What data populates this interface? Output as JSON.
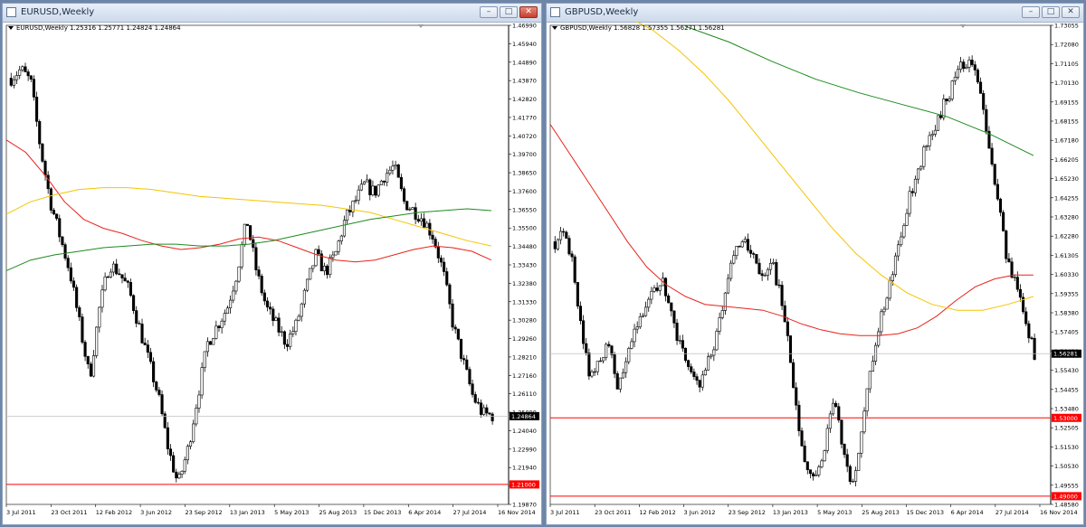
{
  "windows": [
    {
      "id": "eurusd",
      "title": "EURUSD,Weekly",
      "info_symbol": "EURUSD,Weekly",
      "info_ohlc": "1.25316 1.25771 1.24824 1.24864",
      "y_ticks": [
        "1.46990",
        "1.45940",
        "1.44890",
        "1.43870",
        "1.42820",
        "1.41770",
        "1.40720",
        "1.39700",
        "1.38650",
        "1.37600",
        "1.36550",
        "1.35500",
        "1.34480",
        "1.33430",
        "1.32380",
        "1.31330",
        "1.30280",
        "1.29260",
        "1.28210",
        "1.27160",
        "1.26110",
        "1.25090",
        "1.24040",
        "1.22990",
        "1.21940",
        "1.20890",
        "1.19870"
      ],
      "x_ticks": [
        "3 Jul 2011",
        "23 Oct 2011",
        "12 Feb 2012",
        "3 Jun 2012",
        "23 Sep 2012",
        "13 Jan 2013",
        "5 May 2013",
        "25 Aug 2013",
        "15 Dec 2013",
        "6 Apr 2014",
        "27 Jul 2014",
        "16 Nov 2014"
      ],
      "price_label": "1.24864",
      "level_label": "1.21000",
      "colors": {
        "price_label_bg": "#000000",
        "level_label_bg": "#ff0000",
        "level_line": "#ff0000",
        "ma_red": "#e8221b",
        "ma_yellow": "#f5c400",
        "ma_green": "#1d8a1d",
        "candle": "#000000"
      }
    },
    {
      "id": "gbpusd",
      "title": "GBPUSD,Weekly",
      "info_symbol": "GBPUSD,Weekly",
      "info_ohlc": "1.56828 1.57355 1.56271 1.56281",
      "y_ticks": [
        "1.73055",
        "1.72080",
        "1.71105",
        "1.70130",
        "1.69155",
        "1.68155",
        "1.67180",
        "1.66205",
        "1.65230",
        "1.64255",
        "1.63280",
        "1.62280",
        "1.61305",
        "1.60330",
        "1.59355",
        "1.58380",
        "1.57405",
        "1.56430",
        "1.55430",
        "1.54455",
        "1.53480",
        "1.52505",
        "1.51530",
        "1.50530",
        "1.49555",
        "1.48580"
      ],
      "x_ticks": [
        "3 Jul 2011",
        "23 Oct 2011",
        "12 Feb 2012",
        "3 Jun 2012",
        "23 Sep 2012",
        "13 Jan 2013",
        "5 May 2013",
        "25 Aug 2013",
        "15 Dec 2013",
        "6 Apr 2014",
        "27 Jul 2014",
        "16 Nov 2014"
      ],
      "price_label": "1.56281",
      "level_labels": [
        "1.53000",
        "1.49000"
      ],
      "colors": {
        "price_label_bg": "#000000",
        "level_label_bg": "#ff0000",
        "level_line": "#ff0000",
        "ma_red": "#e8221b",
        "ma_yellow": "#f5c400",
        "ma_green": "#1d8a1d",
        "candle": "#000000"
      }
    }
  ],
  "chart_data": [
    {
      "type": "candlestick",
      "title": "EURUSD,Weekly",
      "ylim": [
        1.1987,
        1.4699
      ],
      "x": [
        "3 Jul 2011",
        "23 Oct 2011",
        "12 Feb 2012",
        "3 Jun 2012",
        "23 Sep 2012",
        "13 Jan 2013",
        "5 May 2013",
        "25 Aug 2013",
        "15 Dec 2013",
        "6 Apr 2014",
        "27 Jul 2014",
        "16 Nov 2014"
      ],
      "close_path": [
        1.44,
        1.445,
        1.438,
        1.4,
        1.37,
        1.35,
        1.33,
        1.3,
        1.27,
        1.31,
        1.335,
        1.33,
        1.32,
        1.3,
        1.28,
        1.26,
        1.23,
        1.21,
        1.23,
        1.26,
        1.29,
        1.3,
        1.31,
        1.33,
        1.36,
        1.33,
        1.31,
        1.3,
        1.29,
        1.3,
        1.32,
        1.34,
        1.33,
        1.34,
        1.36,
        1.37,
        1.38,
        1.375,
        1.385,
        1.39,
        1.37,
        1.365,
        1.36,
        1.35,
        1.33,
        1.3,
        1.28,
        1.26,
        1.25,
        1.249
      ],
      "series": [
        {
          "name": "MA red",
          "values": [
            1.405,
            1.398,
            1.385,
            1.37,
            1.36,
            1.355,
            1.352,
            1.348,
            1.345,
            1.343,
            1.344,
            1.346,
            1.349,
            1.35,
            1.348,
            1.344,
            1.34,
            1.337,
            1.336,
            1.337,
            1.34,
            1.343,
            1.345,
            1.344,
            1.342,
            1.337
          ]
        },
        {
          "name": "MA yellow",
          "values": [
            1.363,
            1.37,
            1.374,
            1.377,
            1.378,
            1.378,
            1.377,
            1.375,
            1.373,
            1.372,
            1.371,
            1.37,
            1.369,
            1.368,
            1.366,
            1.364,
            1.36,
            1.356,
            1.352,
            1.348,
            1.345
          ]
        },
        {
          "name": "MA green",
          "values": [
            1.331,
            1.337,
            1.34,
            1.342,
            1.344,
            1.345,
            1.346,
            1.346,
            1.345,
            1.345,
            1.346,
            1.348,
            1.351,
            1.354,
            1.357,
            1.36,
            1.362,
            1.364,
            1.365,
            1.366,
            1.365
          ]
        }
      ],
      "levels": [
        1.21
      ],
      "last_price": 1.24864
    },
    {
      "type": "candlestick",
      "title": "GBPUSD,Weekly",
      "ylim": [
        1.4858,
        1.73055
      ],
      "x": [
        "3 Jul 2011",
        "23 Oct 2011",
        "12 Feb 2012",
        "3 Jun 2012",
        "23 Sep 2012",
        "13 Jan 2013",
        "5 May 2013",
        "25 Aug 2013",
        "15 Dec 2013",
        "6 Apr 2014",
        "27 Jul 2014",
        "16 Nov 2014"
      ],
      "close_path": [
        1.62,
        1.625,
        1.61,
        1.57,
        1.55,
        1.56,
        1.57,
        1.545,
        1.56,
        1.575,
        1.585,
        1.595,
        1.6,
        1.58,
        1.565,
        1.555,
        1.545,
        1.56,
        1.575,
        1.6,
        1.615,
        1.62,
        1.61,
        1.6,
        1.61,
        1.59,
        1.56,
        1.52,
        1.505,
        1.5,
        1.52,
        1.54,
        1.51,
        1.495,
        1.53,
        1.555,
        1.58,
        1.6,
        1.62,
        1.64,
        1.655,
        1.67,
        1.68,
        1.69,
        1.7,
        1.71,
        1.715,
        1.7,
        1.67,
        1.64,
        1.61,
        1.6,
        1.58,
        1.563
      ],
      "series": [
        {
          "name": "MA red",
          "values": [
            1.68,
            1.665,
            1.65,
            1.635,
            1.62,
            1.607,
            1.598,
            1.592,
            1.588,
            1.587,
            1.586,
            1.585,
            1.582,
            1.578,
            1.575,
            1.573,
            1.572,
            1.572,
            1.573,
            1.576,
            1.582,
            1.59,
            1.597,
            1.601,
            1.603,
            1.603
          ]
        },
        {
          "name": "MA yellow",
          "values": [
            1.735,
            1.728,
            1.718,
            1.706,
            1.692,
            1.676,
            1.66,
            1.644,
            1.628,
            1.614,
            1.603,
            1.594,
            1.588,
            1.585,
            1.585,
            1.588,
            1.592
          ]
        },
        {
          "name": "MA green",
          "values": [
            1.73,
            1.722,
            1.712,
            1.703,
            1.696,
            1.69,
            1.684,
            1.675,
            1.664
          ]
        }
      ],
      "levels": [
        1.53,
        1.49
      ],
      "last_price": 1.56281
    }
  ]
}
